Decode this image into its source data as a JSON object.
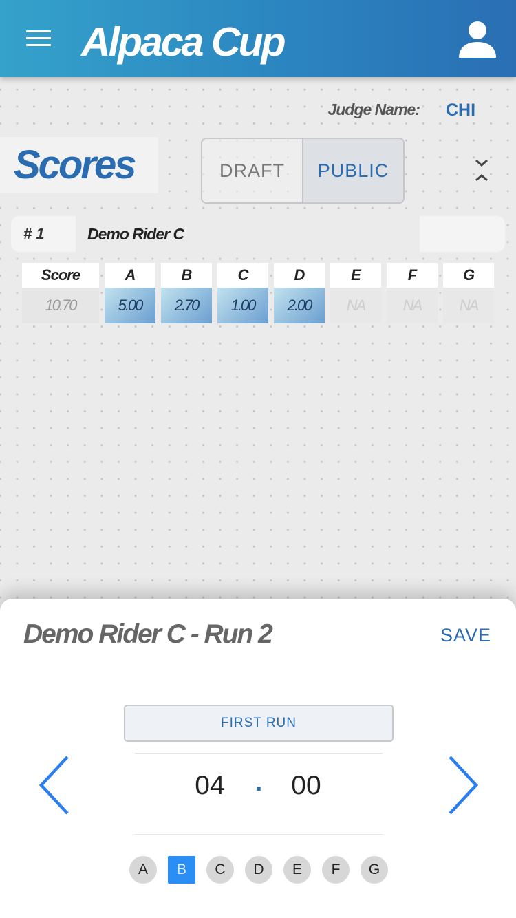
{
  "header": {
    "title": "Alpaca Cup"
  },
  "judge": {
    "label": "Judge Name:",
    "value": "CHI"
  },
  "scores": {
    "title": "Scores",
    "segments": [
      "DRAFT",
      "PUBLIC"
    ],
    "selected_segment": "PUBLIC"
  },
  "rider": {
    "rank": "# 1",
    "name": "Demo Rider C"
  },
  "table": {
    "headers": [
      "Score",
      "A",
      "B",
      "C",
      "D",
      "E",
      "F",
      "G"
    ],
    "values": [
      "10.70",
      "5.00",
      "2.70",
      "1.00",
      "2.00",
      "NA",
      "NA",
      "NA"
    ]
  },
  "sheet": {
    "title": "Demo Rider C - Run 2",
    "save_label": "SAVE",
    "run_button": "FIRST RUN",
    "picker": {
      "whole": "04",
      "separator": ".",
      "fraction": "00"
    },
    "letters": [
      "A",
      "B",
      "C",
      "D",
      "E",
      "F",
      "G"
    ],
    "selected_letter": "B"
  },
  "colors": {
    "accent": "#2b6cb0",
    "header_start": "#35a2cb",
    "header_end": "#2a6fb3",
    "selected_dot": "#2a8ef5"
  },
  "icons": [
    "menu-icon",
    "user-icon",
    "collapse-icon",
    "chevron-left-icon",
    "chevron-right-icon"
  ]
}
